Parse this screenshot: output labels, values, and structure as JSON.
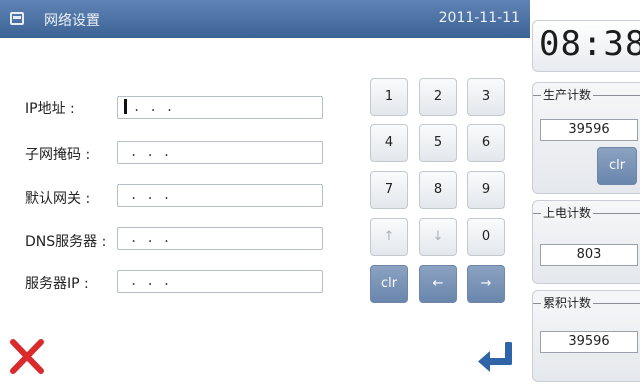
{
  "title_bar": {
    "title": "网络设置",
    "date": "2011-11-11"
  },
  "fields": [
    {
      "label": "IP地址 :",
      "value": ". . ."
    },
    {
      "label": "子网掩码 :",
      "value": ". . ."
    },
    {
      "label": "默认网关 :",
      "value": ". . ."
    },
    {
      "label": "DNS服务器 :",
      "value": ". . ."
    },
    {
      "label": "服务器IP :",
      "value": ". . ."
    }
  ],
  "keypad": {
    "rows": [
      [
        "1",
        "2",
        "3"
      ],
      [
        "4",
        "5",
        "6"
      ],
      [
        "7",
        "8",
        "9"
      ],
      [
        "↑",
        "↓",
        "0"
      ],
      [
        "clr",
        "←",
        "→"
      ]
    ]
  },
  "actions": {
    "cancel_icon": "close-x-icon",
    "enter_icon": "enter-return-icon"
  },
  "side": {
    "clock": "08:38",
    "production": {
      "title": "生产计数",
      "value": "39596",
      "clr_label": "clr"
    },
    "power_on": {
      "title": "上电计数",
      "value": "803"
    },
    "cumulative": {
      "title": "累积计数",
      "value": "39596"
    }
  },
  "colors": {
    "titlebar": "#4a6fa0",
    "cancel": "#d92b2b",
    "enter": "#2f64a8",
    "accent_key": "#7891b5"
  }
}
